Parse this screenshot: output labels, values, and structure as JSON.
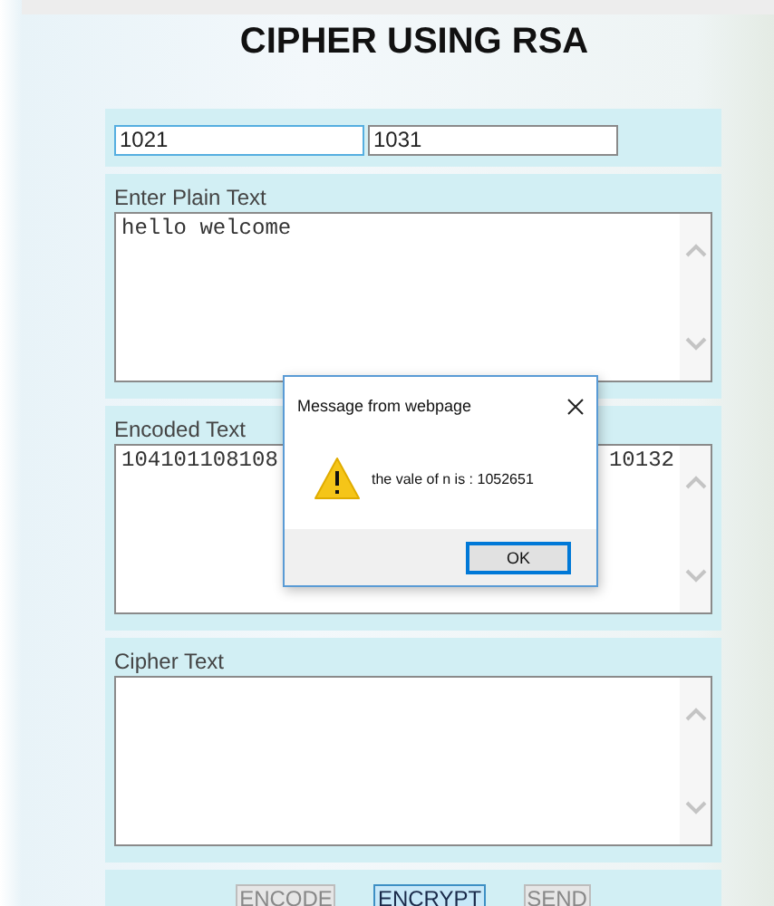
{
  "title": "CIPHER USING RSA",
  "keys": [
    {
      "value": "1021",
      "focused": true
    },
    {
      "value": "1031",
      "focused": false
    }
  ],
  "sections": [
    {
      "label": "Enter Plain Text",
      "text_parts": [
        "hello welcome"
      ]
    },
    {
      "label": "Encoded Text",
      "text_parts": [
        "104101108108",
        "10132"
      ]
    },
    {
      "label": "Cipher Text"
    }
  ],
  "buttons": [
    {
      "label": "ENCODE",
      "selected": false
    },
    {
      "label": "ENCRYPT",
      "selected": true
    },
    {
      "label": "SEND",
      "selected": false
    }
  ],
  "dialog": {
    "title": "Message from webpage",
    "message": "the vale of n is : 1052651",
    "button": "OK"
  }
}
